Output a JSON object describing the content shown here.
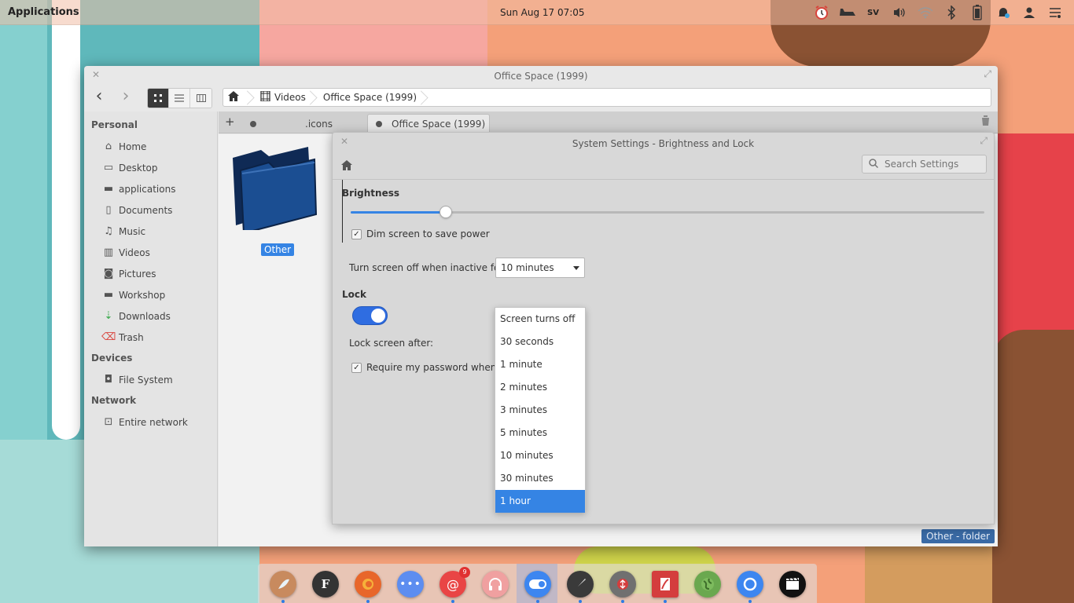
{
  "panel": {
    "applications_label": "Applications",
    "clock": "Sun Aug 17  07:05",
    "keyboard_layout": "SV"
  },
  "file_manager": {
    "title": "Office Space (1999)",
    "breadcrumbs": [
      "Videos",
      "Office Space (1999)"
    ],
    "sidebar": {
      "personal_heading": "Personal",
      "personal": [
        "Home",
        "Desktop",
        "applications",
        "Documents",
        "Music",
        "Videos",
        "Pictures",
        "Workshop",
        "Downloads",
        "Trash"
      ],
      "devices_heading": "Devices",
      "devices": [
        "File System"
      ],
      "network_heading": "Network",
      "network": [
        "Entire network"
      ]
    },
    "tabs": [
      ".icons",
      "Office Space (1999)"
    ],
    "items": [
      {
        "name": "Other"
      }
    ],
    "status_tip": "Other - folder"
  },
  "settings": {
    "title": "System Settings - Brightness and Lock",
    "search_placeholder": "Search Settings",
    "brightness_heading": "Brightness",
    "brightness_level": 0.15,
    "dim_label": "Dim screen to save power",
    "dim_checked": true,
    "screen_off_label": "Turn screen off when inactive for:",
    "screen_off_value": "10 minutes",
    "lock_heading": "Lock",
    "lock_on": true,
    "lock_after_label": "Lock screen after:",
    "require_password_label": "Require my password when wa",
    "require_password_checked": true,
    "lock_after_options": [
      "Screen turns off",
      "30 seconds",
      "1 minute",
      "2 minutes",
      "3 minutes",
      "5 minutes",
      "10 minutes",
      "30 minutes",
      "1 hour"
    ],
    "lock_after_selected": "1 hour"
  },
  "dock": {
    "apps": [
      {
        "name": "files",
        "color": "#c88a5e"
      },
      {
        "name": "font-viewer",
        "color": "#333333"
      },
      {
        "name": "firefox",
        "color": "#e8662a"
      },
      {
        "name": "more",
        "color": "#5d8df0"
      },
      {
        "name": "mail",
        "color": "#e94545",
        "badge": "9"
      },
      {
        "name": "music",
        "color": "#f0a0a0"
      },
      {
        "name": "settings-toggle",
        "color": "#3d86f0"
      },
      {
        "name": "brush",
        "color": "#3a3a3a"
      },
      {
        "name": "transfer",
        "color": "#707070"
      },
      {
        "name": "document-viewer",
        "color": "#d43d3d"
      },
      {
        "name": "browser-globe",
        "color": "#6aa84f"
      },
      {
        "name": "circle-app",
        "color": "#3d86f0"
      },
      {
        "name": "video-player",
        "color": "#111111"
      }
    ]
  }
}
